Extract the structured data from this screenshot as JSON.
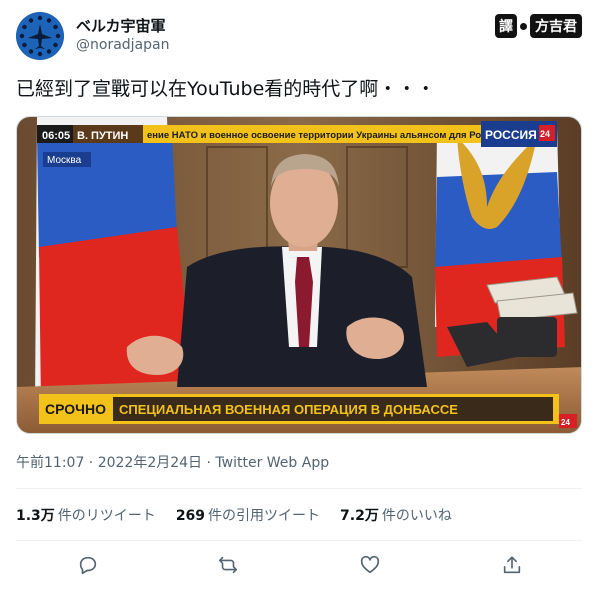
{
  "user": {
    "display_name": "ベルカ宇宙軍",
    "handle": "@noradjapan"
  },
  "badge": {
    "part1": "譯",
    "part2": "方吉君"
  },
  "tweet": {
    "text": "已經到了宣戰可以在YouTube看的時代了啊・・・"
  },
  "media": {
    "time": "06:05",
    "speaker": "В. ПУТИН",
    "ticker": "ение НАТО и военное освоение территории Украины альянсом для Росси",
    "channel": "РОССИЯ",
    "channel_num": "24",
    "location": "Москва",
    "urgent": "СРОЧНО",
    "headline": "СПЕЦИАЛЬНАЯ ВОЕННАЯ ОПЕРАЦИЯ В ДОНБАССЕ",
    "corner_num": "24"
  },
  "meta": {
    "timestamp": "午前11:07 · 2022年2月24日 · Twitter Web App"
  },
  "stats": {
    "retweets_count": "1.3万",
    "retweets_label": "件のリツイート",
    "quotes_count": "269",
    "quotes_label": "件の引用ツイート",
    "likes_count": "7.2万",
    "likes_label": "件のいいね"
  },
  "icons": {
    "reply": "reply-icon",
    "retweet": "retweet-icon",
    "like": "like-icon",
    "share": "share-icon"
  },
  "colors": {
    "text_primary": "#0f1419",
    "text_secondary": "#536471",
    "avatar_bg": "#1d63b8",
    "banner_yellow": "#f2c21b",
    "banner_dark": "#3a2a1a",
    "urgent_red": "#d61f26"
  }
}
